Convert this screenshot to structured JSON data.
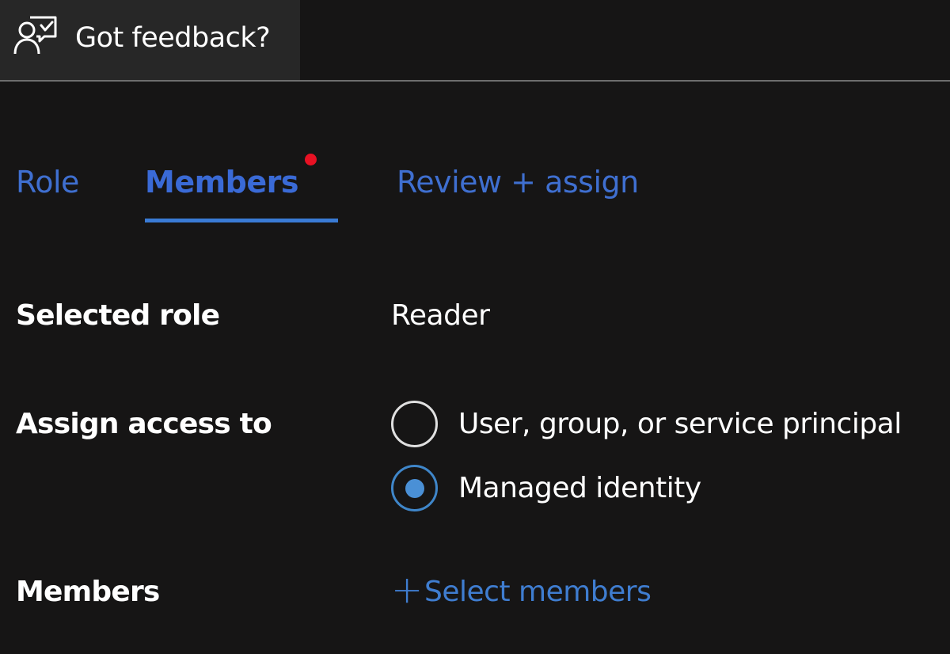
{
  "topbar": {
    "feedback_label": "Got feedback?",
    "feedback_icon": "person-feedback-icon"
  },
  "tabs": [
    {
      "label": "Role",
      "active": false
    },
    {
      "label": "Members",
      "active": true,
      "has_indicator": true
    },
    {
      "label": "Review + assign",
      "active": false
    }
  ],
  "form": {
    "selected_role": {
      "label": "Selected role",
      "value": "Reader"
    },
    "assign_access": {
      "label": "Assign access to",
      "options": [
        {
          "label": "User, group, or service principal",
          "checked": false
        },
        {
          "label": "Managed identity",
          "checked": true
        }
      ]
    },
    "members": {
      "label": "Members",
      "action_label": "Select members",
      "action_icon": "plus-icon"
    }
  },
  "colors": {
    "background": "#161515",
    "accent": "#3a6ad6",
    "indicator": "#e81123",
    "radio_checked": "#4a90d6"
  }
}
